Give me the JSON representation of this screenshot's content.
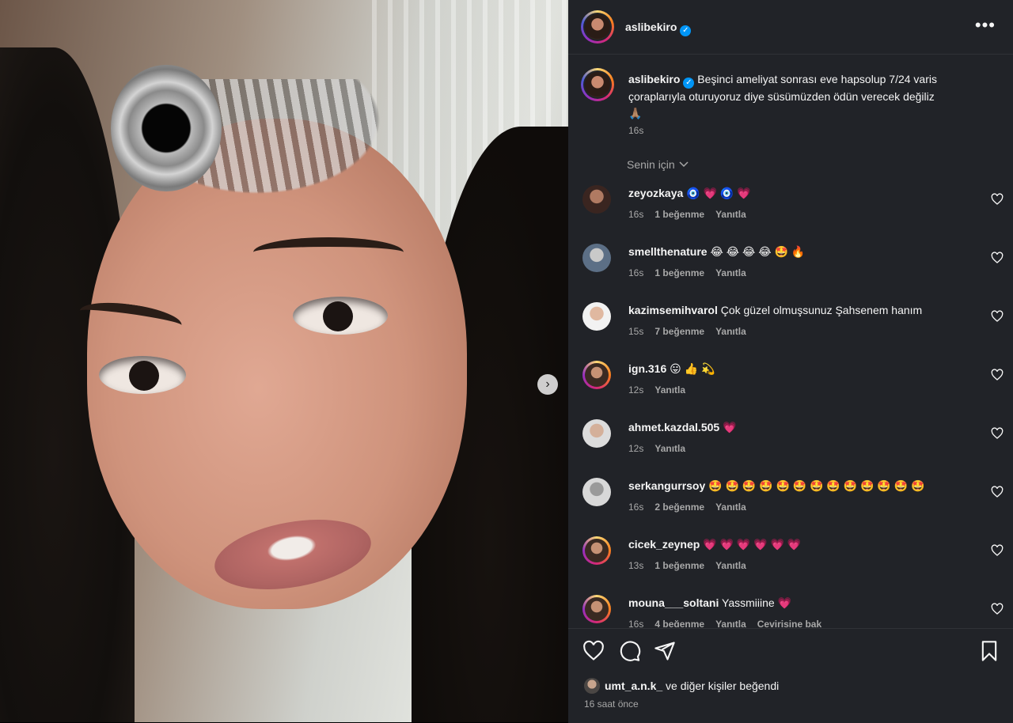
{
  "post": {
    "username": "aslibekiro",
    "verified": true,
    "caption_text": "Beşinci ameliyat sonrası eve hapsolup 7/24 varis çoraplarıyla oturuyoruz diye süsümüzden ödün verecek değiliz",
    "caption_emoji": "🙏🏽",
    "caption_time": "16s",
    "for_you_label": "Senin için",
    "more_options": "•••"
  },
  "comments": [
    {
      "user": "zeyozkaya",
      "text": "🧿 💗 🧿 💗",
      "time": "16s",
      "likes": "1 beğenme",
      "reply": "Yanıtla",
      "translate": ""
    },
    {
      "user": "smellthenature",
      "text": "😂 😂 😂 😂 🤩 🔥",
      "time": "16s",
      "likes": "1 beğenme",
      "reply": "Yanıtla",
      "translate": ""
    },
    {
      "user": "kazimsemihvarol",
      "text": "Çok güzel olmuşsunuz Şahsenem hanım",
      "time": "15s",
      "likes": "7 beğenme",
      "reply": "Yanıtla",
      "translate": ""
    },
    {
      "user": "ign.316",
      "text": "😛 👍 💫",
      "time": "12s",
      "likes": "",
      "reply": "Yanıtla",
      "translate": ""
    },
    {
      "user": "ahmet.kazdal.505",
      "text": "💗",
      "time": "12s",
      "likes": "",
      "reply": "Yanıtla",
      "translate": ""
    },
    {
      "user": "serkangurrsoy",
      "text": "🤩 🤩 🤩 🤩 🤩 🤩 🤩 🤩 🤩 🤩 🤩 🤩 🤩",
      "time": "16s",
      "likes": "2 beğenme",
      "reply": "Yanıtla",
      "translate": ""
    },
    {
      "user": "cicek_zeynep",
      "text": "💗 💗 💗 💗 💗 💗",
      "time": "13s",
      "likes": "1 beğenme",
      "reply": "Yanıtla",
      "translate": ""
    },
    {
      "user": "mouna___soltani",
      "text": "Yassmiiine 💗",
      "time": "16s",
      "likes": "4 beğenme",
      "reply": "Yanıtla",
      "translate": "Çevirisine bak"
    }
  ],
  "footer": {
    "liked_by_user": "umt_a.n.k_",
    "liked_by_text": " ve diğer kişiler ",
    "liked_label": "beğendi",
    "post_age": "16 saat önce"
  },
  "colors": {
    "panel_bg": "#212328",
    "secondary_text": "#a8a8a8",
    "verified": "#0095f6"
  },
  "icons": [
    "like-heart-icon",
    "comment-icon",
    "share-icon",
    "save-bookmark-icon",
    "chevron-right-icon",
    "chevron-down-icon",
    "more-options-icon",
    "verified-badge-icon"
  ]
}
